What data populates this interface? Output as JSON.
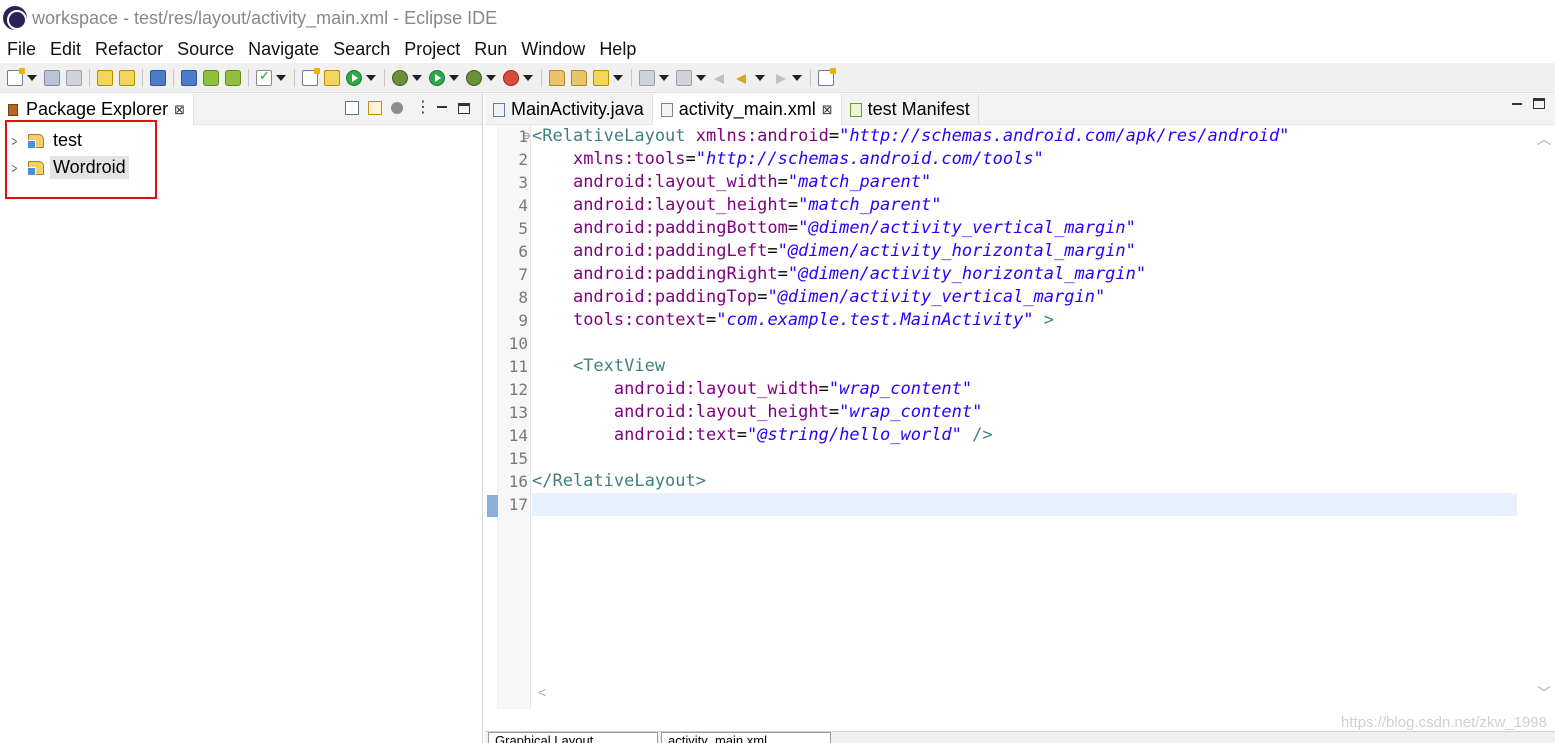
{
  "window": {
    "title": "workspace - test/res/layout/activity_main.xml - Eclipse IDE"
  },
  "menu": {
    "items": [
      "File",
      "Edit",
      "Refactor",
      "Source",
      "Navigate",
      "Search",
      "Project",
      "Run",
      "Window",
      "Help"
    ]
  },
  "package_explorer": {
    "tab_label": "Package Explorer",
    "projects": [
      {
        "name": "test",
        "selected": false
      },
      {
        "name": "Wordroid",
        "selected": true
      }
    ]
  },
  "editor": {
    "tabs": [
      {
        "label": "MainActivity.java",
        "active": false,
        "icon": "java-file-icon"
      },
      {
        "label": "activity_main.xml",
        "active": true,
        "icon": "xml-file-icon"
      },
      {
        "label": "test Manifest",
        "active": false,
        "icon": "android-manifest-icon"
      }
    ],
    "line_numbers": [
      "1",
      "2",
      "3",
      "4",
      "5",
      "6",
      "7",
      "8",
      "9",
      "10",
      "11",
      "12",
      "13",
      "14",
      "15",
      "16",
      "17"
    ],
    "current_line": 17,
    "code_lines": [
      [
        [
          "tag",
          "<RelativeLayout "
        ],
        [
          "attr",
          "xmlns:android"
        ],
        [
          "pun",
          "="
        ],
        [
          "val",
          "\"http://schemas.android.com/apk/res/android\""
        ]
      ],
      [
        [
          "pun",
          "    "
        ],
        [
          "attr",
          "xmlns:tools"
        ],
        [
          "pun",
          "="
        ],
        [
          "val",
          "\"http://schemas.android.com/tools\""
        ]
      ],
      [
        [
          "pun",
          "    "
        ],
        [
          "attr",
          "android:layout_width"
        ],
        [
          "pun",
          "="
        ],
        [
          "val",
          "\"match_parent\""
        ]
      ],
      [
        [
          "pun",
          "    "
        ],
        [
          "attr",
          "android:layout_height"
        ],
        [
          "pun",
          "="
        ],
        [
          "val",
          "\"match_parent\""
        ]
      ],
      [
        [
          "pun",
          "    "
        ],
        [
          "attr",
          "android:paddingBottom"
        ],
        [
          "pun",
          "="
        ],
        [
          "val",
          "\"@dimen/activity_vertical_margin\""
        ]
      ],
      [
        [
          "pun",
          "    "
        ],
        [
          "attr",
          "android:paddingLeft"
        ],
        [
          "pun",
          "="
        ],
        [
          "val",
          "\"@dimen/activity_horizontal_margin\""
        ]
      ],
      [
        [
          "pun",
          "    "
        ],
        [
          "attr",
          "android:paddingRight"
        ],
        [
          "pun",
          "="
        ],
        [
          "val",
          "\"@dimen/activity_horizontal_margin\""
        ]
      ],
      [
        [
          "pun",
          "    "
        ],
        [
          "attr",
          "android:paddingTop"
        ],
        [
          "pun",
          "="
        ],
        [
          "val",
          "\"@dimen/activity_vertical_margin\""
        ]
      ],
      [
        [
          "pun",
          "    "
        ],
        [
          "attr",
          "tools:context"
        ],
        [
          "pun",
          "="
        ],
        [
          "val",
          "\"com.example.test.MainActivity\""
        ],
        [
          "tag",
          " >"
        ]
      ],
      [],
      [
        [
          "pun",
          "    "
        ],
        [
          "tag",
          "<TextView"
        ]
      ],
      [
        [
          "pun",
          "        "
        ],
        [
          "attr",
          "android:layout_width"
        ],
        [
          "pun",
          "="
        ],
        [
          "val",
          "\"wrap_content\""
        ]
      ],
      [
        [
          "pun",
          "        "
        ],
        [
          "attr",
          "android:layout_height"
        ],
        [
          "pun",
          "="
        ],
        [
          "val",
          "\"wrap_content\""
        ]
      ],
      [
        [
          "pun",
          "        "
        ],
        [
          "attr",
          "android:text"
        ],
        [
          "pun",
          "="
        ],
        [
          "val",
          "\"@string/hello_world\""
        ],
        [
          "tag",
          " />"
        ]
      ],
      [],
      [
        [
          "tag",
          "</RelativeLayout>"
        ]
      ],
      []
    ],
    "bottom_tabs": [
      "Graphical Layout",
      "activity_main.xml"
    ]
  },
  "watermark": "https://blog.csdn.net/zkw_1998",
  "colors": {
    "tag": "#3f7f7f",
    "attribute": "#7f007f",
    "value": "#2a00ff",
    "current_line": "#e8f2fe",
    "highlight_box": "#e01010"
  }
}
